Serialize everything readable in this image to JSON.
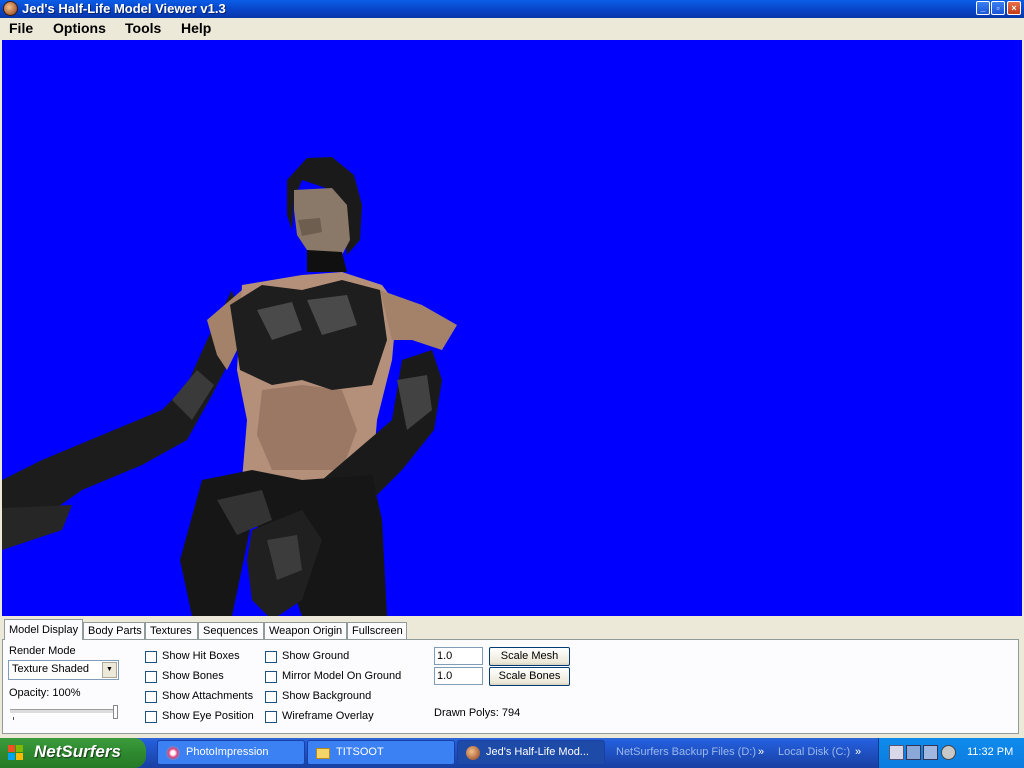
{
  "window": {
    "title": "Jed's Half-Life Model Viewer v1.3"
  },
  "menu": [
    "File",
    "Options",
    "Tools",
    "Help"
  ],
  "viewport": {
    "background": "#0000ff"
  },
  "tabs": [
    "Model Display",
    "Body Parts",
    "Textures",
    "Sequences",
    "Weapon Origin",
    "Fullscreen"
  ],
  "active_tab": "Model Display",
  "model_display": {
    "render_mode_label": "Render Mode",
    "render_mode_value": "Texture Shaded",
    "opacity_label": "Opacity: 100%",
    "opacity_value": 1.0,
    "checkboxes_col1": [
      "Show Hit Boxes",
      "Show Bones",
      "Show Attachments",
      "Show Eye Position"
    ],
    "checkboxes_col2": [
      "Show Ground",
      "Mirror Model On Ground",
      "Show Background",
      "Wireframe Overlay"
    ],
    "scale_mesh_value": "1.0",
    "scale_bones_value": "1.0",
    "scale_mesh_button": "Scale Mesh",
    "scale_bones_button": "Scale Bones",
    "drawn_polys": "Drawn Polys: 794"
  },
  "taskbar": {
    "start_label": "NetSurfers",
    "tasks": [
      "PhotoImpression",
      "TITSOOT",
      "Jed's Half-Life Mod..."
    ],
    "quicklaunch": [
      "NetSurfers Backup Files (D:)",
      "Local Disk (C:)"
    ],
    "clock": "11:32 PM"
  }
}
